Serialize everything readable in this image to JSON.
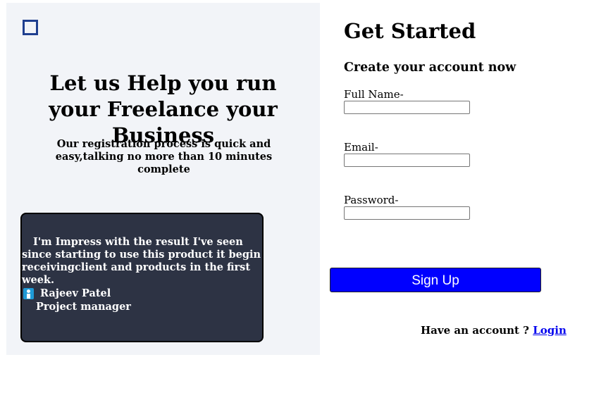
{
  "left": {
    "headline": "Let us Help you run your Freelance your Business",
    "subhead": "Our registration process is quick and easy,talking no more than 10 minutes complete",
    "testimonial": {
      "quote_part1": "I'm Impress with the result I've seen",
      "quote_part2": "since starting to use this product it begin receivingclient and products in the first week.",
      "author_name": "Rajeev Patel",
      "author_role": "Project manager",
      "author_icon": "person-icon"
    },
    "logo_icon": "square-outline-icon"
  },
  "form": {
    "title": "Get Started",
    "subtitle": "Create your account now",
    "fields": [
      {
        "label": "Full Name-",
        "value": ""
      },
      {
        "label": "Email-",
        "value": ""
      },
      {
        "label": "Password-",
        "value": ""
      }
    ],
    "submit_label": "Sign Up",
    "login_prompt": "Have an account ?",
    "login_link": "Login"
  },
  "colors": {
    "panel_bg": "#f2f4f8",
    "card_bg": "#2d3344",
    "button_bg": "#0000ff",
    "link": "#0000ee",
    "logo": "#1f3f8f"
  }
}
